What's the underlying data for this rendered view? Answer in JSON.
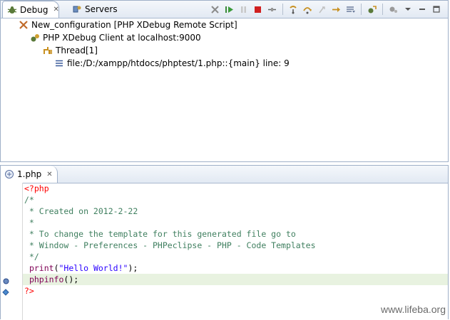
{
  "debug_view": {
    "tabs": [
      {
        "label": "Debug",
        "icon": "debug-bug-icon",
        "close": "✕"
      },
      {
        "label": "Servers",
        "icon": "servers-icon"
      }
    ],
    "tree": [
      {
        "label": "New_configuration [PHP XDebug Remote Script]",
        "icon": "launch-config-icon"
      },
      {
        "label": "PHP XDebug Client at localhost:9000",
        "icon": "debug-target-icon"
      },
      {
        "label": "Thread[1]",
        "icon": "thread-icon"
      },
      {
        "label": "file:/D:/xampp/htdocs/phptest/1.php::{main} line: 9",
        "icon": "stack-frame-icon"
      }
    ]
  },
  "editor": {
    "tab": {
      "label": "1.php",
      "close": "✕"
    },
    "lines": [
      "<?php",
      "/*",
      " * Created on 2012-2-22",
      " *",
      " * To change the template for this generated file go to",
      " * Window - Preferences - PHPeclipse - PHP - Code Templates",
      " */",
      " print(\"Hello World!\");",
      " phpinfo();",
      "?>"
    ]
  },
  "watermark": "www.lifeba.org",
  "colors": {
    "keyword": "#7f0055",
    "comment": "#3f7f5f",
    "string": "#2a00ff",
    "php_tag": "#ff0000",
    "current_line": "#e8f2e0"
  }
}
